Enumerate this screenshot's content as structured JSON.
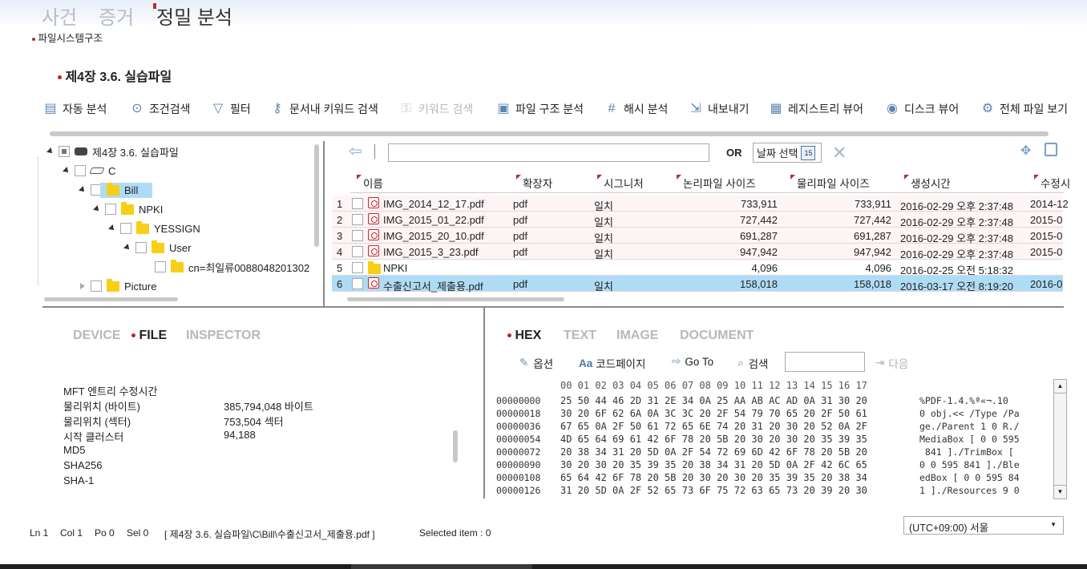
{
  "main_tabs": [
    "사건",
    "증거",
    "정밀 분석"
  ],
  "breadcrumb": "파일시스템구조",
  "case_title": "제4장 3.6. 실습파일",
  "toolbar": [
    {
      "label": "자동 분석",
      "icon": "chart-icon"
    },
    {
      "label": "조건검색",
      "icon": "search-check-icon"
    },
    {
      "label": "필터",
      "icon": "filter-icon"
    },
    {
      "label": "문서내 키워드 검색",
      "icon": "doc-key-icon"
    },
    {
      "label": "키워드 검색",
      "icon": "key-icon"
    },
    {
      "label": "파일 구조 분석",
      "icon": "file-structure-icon"
    },
    {
      "label": "해시 분석",
      "icon": "hash-icon"
    },
    {
      "label": "내보내기",
      "icon": "export-icon"
    },
    {
      "label": "레지스트리 뷰어",
      "icon": "registry-icon"
    },
    {
      "label": "디스크 뷰어",
      "icon": "disk-icon"
    },
    {
      "label": "전체 파일 보기",
      "icon": "all-files-icon"
    }
  ],
  "tree": [
    {
      "label": "제4장 3.6. 실습파일",
      "type": "case"
    },
    {
      "label": "C",
      "type": "drive"
    },
    {
      "label": "Bill",
      "type": "folder"
    },
    {
      "label": "NPKI",
      "type": "folder"
    },
    {
      "label": "YESSIGN",
      "type": "folder"
    },
    {
      "label": "User",
      "type": "folder"
    },
    {
      "label": "cn=최일류0088048201302",
      "type": "folder"
    },
    {
      "label": "Picture",
      "type": "folder"
    }
  ],
  "filter_bar": {
    "search_value": "",
    "or_label": "OR",
    "date_label": "날짜 선택",
    "calendar_day": "15"
  },
  "columns": [
    "이름",
    "확장자",
    "시그니처",
    "논리파일 사이즈",
    "물리파일 사이즈",
    "생성시간",
    "수정시"
  ],
  "rows": [
    {
      "n": "1",
      "name": "IMG_2014_12_17.pdf",
      "ext": "pdf",
      "sig": "일치",
      "logical": "733,911",
      "physical": "733,911",
      "created": "2016-02-29 오후 2:37:48",
      "modified": "2014-12",
      "kind": "pdf"
    },
    {
      "n": "2",
      "name": "IMG_2015_01_22.pdf",
      "ext": "pdf",
      "sig": "일치",
      "logical": "727,442",
      "physical": "727,442",
      "created": "2016-02-29 오후 2:37:48",
      "modified": "2015-0",
      "kind": "pdf"
    },
    {
      "n": "3",
      "name": "IMG_2015_20_10.pdf",
      "ext": "pdf",
      "sig": "일치",
      "logical": "691,287",
      "physical": "691,287",
      "created": "2016-02-29 오후 2:37:48",
      "modified": "2015-0",
      "kind": "pdf"
    },
    {
      "n": "4",
      "name": "IMG_2015_3_23.pdf",
      "ext": "pdf",
      "sig": "일치",
      "logical": "947,942",
      "physical": "947,942",
      "created": "2016-02-29 오후 2:37:48",
      "modified": "2015-0",
      "kind": "pdf"
    },
    {
      "n": "5",
      "name": "NPKI",
      "ext": "",
      "sig": "",
      "logical": "4,096",
      "physical": "4,096",
      "created": "2016-02-25 오전 5:18:32",
      "modified": "",
      "kind": "folder"
    },
    {
      "n": "6",
      "name": "수출신고서_제출용.pdf",
      "ext": "pdf",
      "sig": "일치",
      "logical": "158,018",
      "physical": "158,018",
      "created": "2016-03-17 오전 8:19:20",
      "modified": "2016-0",
      "kind": "pdf"
    }
  ],
  "info_tabs": [
    "DEVICE",
    "FILE",
    "INSPECTOR"
  ],
  "properties": [
    {
      "key": "MFT 엔트리 수정시간",
      "value": ""
    },
    {
      "key": "물리위치 (바이트)",
      "value": "385,794,048 바이트"
    },
    {
      "key": "물리위치 (섹터)",
      "value": "753,504 섹터"
    },
    {
      "key": "시작 클러스터",
      "value": "94,188"
    },
    {
      "key": "MD5",
      "value": ""
    },
    {
      "key": "SHA256",
      "value": ""
    },
    {
      "key": "SHA-1",
      "value": ""
    }
  ],
  "viewer_tabs": [
    "HEX",
    "TEXT",
    "IMAGE",
    "DOCUMENT"
  ],
  "hex_toolbar": {
    "options": "옵션",
    "codepage": "코드페이지",
    "goto": "Go To",
    "search": "검색",
    "search_value": "",
    "next": "다음"
  },
  "hex_header": "00 01 02 03 04 05 06 07 08 09 10 11 12 13 14 15 16 17",
  "hex_rows": [
    {
      "offset": "00000000",
      "bytes": "25 50 44 46 2D 31 2E 34 0A 25 AA AB AC AD 0A 31 30 20",
      "ascii": "%PDF-1.4.%ª«¬.10"
    },
    {
      "offset": "00000018",
      "bytes": "30 20 6F 62 6A 0A 3C 3C 20 2F 54 79 70 65 20 2F 50 61",
      "ascii": "0 obj.<< /Type /Pa"
    },
    {
      "offset": "00000036",
      "bytes": "67 65 0A 2F 50 61 72 65 6E 74 20 31 20 30 20 52 0A 2F",
      "ascii": "ge./Parent 1 0 R./"
    },
    {
      "offset": "00000054",
      "bytes": "4D 65 64 69 61 42 6F 78 20 5B 20 30 20 30 20 35 39 35",
      "ascii": "MediaBox [ 0 0 595"
    },
    {
      "offset": "00000072",
      "bytes": "20 38 34 31 20 5D 0A 2F 54 72 69 6D 42 6F 78 20 5B 20",
      "ascii": " 841 ]./TrimBox [ "
    },
    {
      "offset": "00000090",
      "bytes": "30 20 30 20 35 39 35 20 38 34 31 20 5D 0A 2F 42 6C 65",
      "ascii": "0 0 595 841 ]./Ble"
    },
    {
      "offset": "00000108",
      "bytes": "65 64 42 6F 78 20 5B 20 30 20 30 20 35 39 35 20 38 34",
      "ascii": "edBox [ 0 0 595 84"
    },
    {
      "offset": "00000126",
      "bytes": "31 20 5D 0A 2F 52 65 73 6F 75 72 63 65 73 20 39 20 30",
      "ascii": "1 ]./Resources 9 0"
    }
  ],
  "status": {
    "ln": "Ln 1",
    "col": "Col 1",
    "po": "Po 0",
    "sel": "Sel 0",
    "path": "[ 제4장 3.6. 실습파일\\C\\Bill\\수출신고서_제출용.pdf ]",
    "selected": "Selected item : 0"
  },
  "timezone": "(UTC+09:00) 서울",
  "colors": {
    "accent": "#c0292c",
    "selection": "#aedcf7"
  }
}
